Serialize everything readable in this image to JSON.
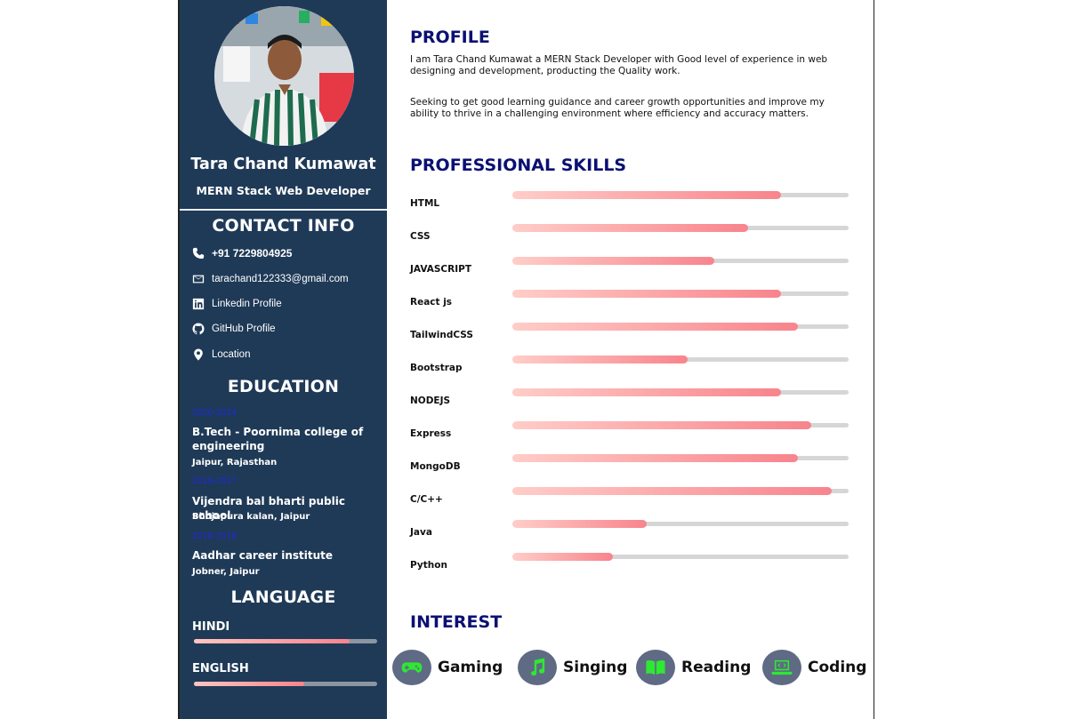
{
  "profile": {
    "name": "Tara Chand Kumawat",
    "role": "MERN Stack Web Developer"
  },
  "contact": {
    "title": "CONTACT INFO",
    "items": [
      {
        "icon": "phone-icon",
        "text": "+91 7229804925"
      },
      {
        "icon": "mail-icon",
        "text": "tarachand122333@gmail.com"
      },
      {
        "icon": "linkedin-icon",
        "text": "Linkedin Profile"
      },
      {
        "icon": "github-icon",
        "text": "GitHub Profile"
      },
      {
        "icon": "location-icon",
        "text": "Location"
      }
    ]
  },
  "education": {
    "title": "EDUCATION",
    "items": [
      {
        "years": "2020-2024",
        "school": "B.Tech - Poornima college of engineering",
        "place": "Jaipur, Rajasthan"
      },
      {
        "years": "2016-2017",
        "school": "Vijendra bal bharti public school",
        "place": "Bhojapura kalan, Jaipur"
      },
      {
        "years": "2018-2019",
        "school": "Aadhar career institute",
        "place": "Jobner, Jaipur"
      }
    ]
  },
  "language": {
    "title": "LANGUAGE",
    "items": [
      {
        "name": "HINDI",
        "level": 0.85
      },
      {
        "name": "ENGLISH",
        "level": 0.6
      }
    ]
  },
  "about": {
    "title": "PROFILE",
    "paragraph1": "I am Tara Chand Kumawat a MERN Stack Developer with Good level of experience in web designing and development, producting the Quality work.",
    "paragraph2": "Seeking to get good learning guidance and career growth opportunities and improve my ability to thrive in a challenging environment where efficiency and accuracy matters."
  },
  "skills": {
    "title": "PROFESSIONAL SKILLS",
    "items": [
      {
        "name": "HTML",
        "level": 0.8
      },
      {
        "name": "CSS",
        "level": 0.7
      },
      {
        "name": "JAVASCRIPT",
        "level": 0.6
      },
      {
        "name": "React js",
        "level": 0.8
      },
      {
        "name": "TailwindCSS",
        "level": 0.85
      },
      {
        "name": "Bootstrap",
        "level": 0.52
      },
      {
        "name": "NODEJS",
        "level": 0.8
      },
      {
        "name": "Express",
        "level": 0.89
      },
      {
        "name": "MongoDB",
        "level": 0.85
      },
      {
        "name": "C/C++",
        "level": 0.95
      },
      {
        "name": "Java",
        "level": 0.4
      },
      {
        "name": "Python",
        "level": 0.3
      }
    ]
  },
  "interest": {
    "title": "INTEREST",
    "items": [
      {
        "icon": "gamepad-icon",
        "label": "Gaming"
      },
      {
        "icon": "music-note-icon",
        "label": "Singing"
      },
      {
        "icon": "book-icon",
        "label": "Reading"
      },
      {
        "icon": "laptop-code-icon",
        "label": "Coding"
      }
    ],
    "icon_color": "#2ee832"
  }
}
